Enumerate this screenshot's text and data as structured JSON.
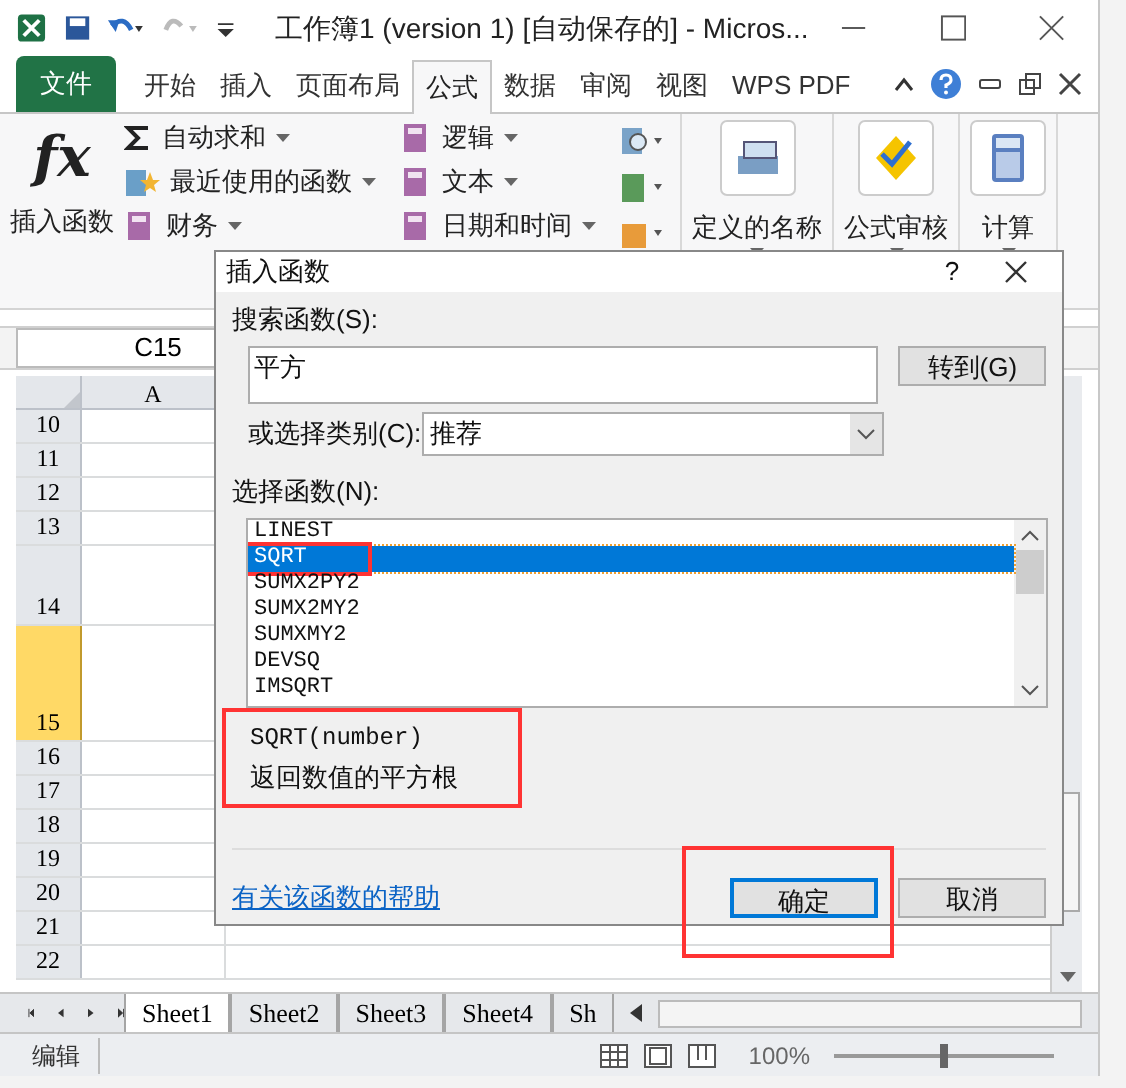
{
  "window": {
    "title": "工作簿1 (version 1) [自动保存的]  -  Micros..."
  },
  "ribbon_tabs": [
    {
      "label": "文件",
      "kind": "file",
      "selected": false
    },
    {
      "label": "开始",
      "kind": "tab",
      "selected": false
    },
    {
      "label": "插入",
      "kind": "tab",
      "selected": false
    },
    {
      "label": "页面布局",
      "kind": "tab",
      "selected": false
    },
    {
      "label": "公式",
      "kind": "tab",
      "selected": true
    },
    {
      "label": "数据",
      "kind": "tab",
      "selected": false
    },
    {
      "label": "审阅",
      "kind": "tab",
      "selected": false
    },
    {
      "label": "视图",
      "kind": "tab",
      "selected": false
    },
    {
      "label": "WPS PDF",
      "kind": "tab",
      "selected": false
    }
  ],
  "ribbon": {
    "insert_function": {
      "symbol": "fx",
      "label": "插入函数"
    },
    "library": [
      {
        "label": "自动求和"
      },
      {
        "label": "最近使用的函数"
      },
      {
        "label": "财务"
      },
      {
        "label": "逻辑"
      },
      {
        "label": "文本"
      },
      {
        "label": "日期和时间"
      }
    ],
    "groups": [
      {
        "label": "定义的名称"
      },
      {
        "label": "公式审核"
      },
      {
        "label": "计算"
      }
    ]
  },
  "name_box": "C15",
  "column_header": "A",
  "rows": [
    {
      "label": "10",
      "kind": "normal",
      "selected": false
    },
    {
      "label": "11",
      "kind": "normal",
      "selected": false
    },
    {
      "label": "12",
      "kind": "normal",
      "selected": false
    },
    {
      "label": "13",
      "kind": "normal",
      "selected": false
    },
    {
      "label": "14",
      "kind": "tall",
      "selected": false
    },
    {
      "label": "15",
      "kind": "taller",
      "selected": true
    },
    {
      "label": "16",
      "kind": "normal",
      "selected": false
    },
    {
      "label": "17",
      "kind": "normal",
      "selected": false
    },
    {
      "label": "18",
      "kind": "normal",
      "selected": false
    },
    {
      "label": "19",
      "kind": "normal",
      "selected": false
    },
    {
      "label": "20",
      "kind": "normal",
      "selected": false
    },
    {
      "label": "21",
      "kind": "normal",
      "selected": false
    },
    {
      "label": "22",
      "kind": "normal",
      "selected": false
    }
  ],
  "sheet_tabs": [
    {
      "label": "Sheet1",
      "selected": true
    },
    {
      "label": "Sheet2",
      "selected": false
    },
    {
      "label": "Sheet3",
      "selected": false
    },
    {
      "label": "Sheet4",
      "selected": false
    },
    {
      "label": "Sh",
      "selected": false
    }
  ],
  "status_bar": {
    "mode": "编辑",
    "zoom": "100%",
    "zoom_slider": {
      "level": 0.5
    }
  },
  "dialog": {
    "title": "插入函数",
    "help": "?",
    "search_label": "搜索函数(S):",
    "search_value": "平方",
    "go_button": "转到(G)",
    "category_label": "或选择类别(C):",
    "category": "推荐",
    "list_label": "选择函数(N):",
    "functions": [
      {
        "name": "LINEST",
        "selected": false,
        "highlighted": false
      },
      {
        "name": "SQRT",
        "selected": true,
        "highlighted": true
      },
      {
        "name": "SUMX2PY2",
        "selected": false,
        "highlighted": false
      },
      {
        "name": "SUMX2MY2",
        "selected": false,
        "highlighted": false
      },
      {
        "name": "SUMXMY2",
        "selected": false,
        "highlighted": false
      },
      {
        "name": "DEVSQ",
        "selected": false,
        "highlighted": false
      },
      {
        "name": "IMSQRT",
        "selected": false,
        "highlighted": false
      }
    ],
    "signature": "SQRT(number)",
    "description": "返回数值的平方根",
    "description_highlighted": true,
    "help_link": "有关该函数的帮助",
    "ok": "确定",
    "ok_highlighted": true,
    "cancel": "取消"
  }
}
